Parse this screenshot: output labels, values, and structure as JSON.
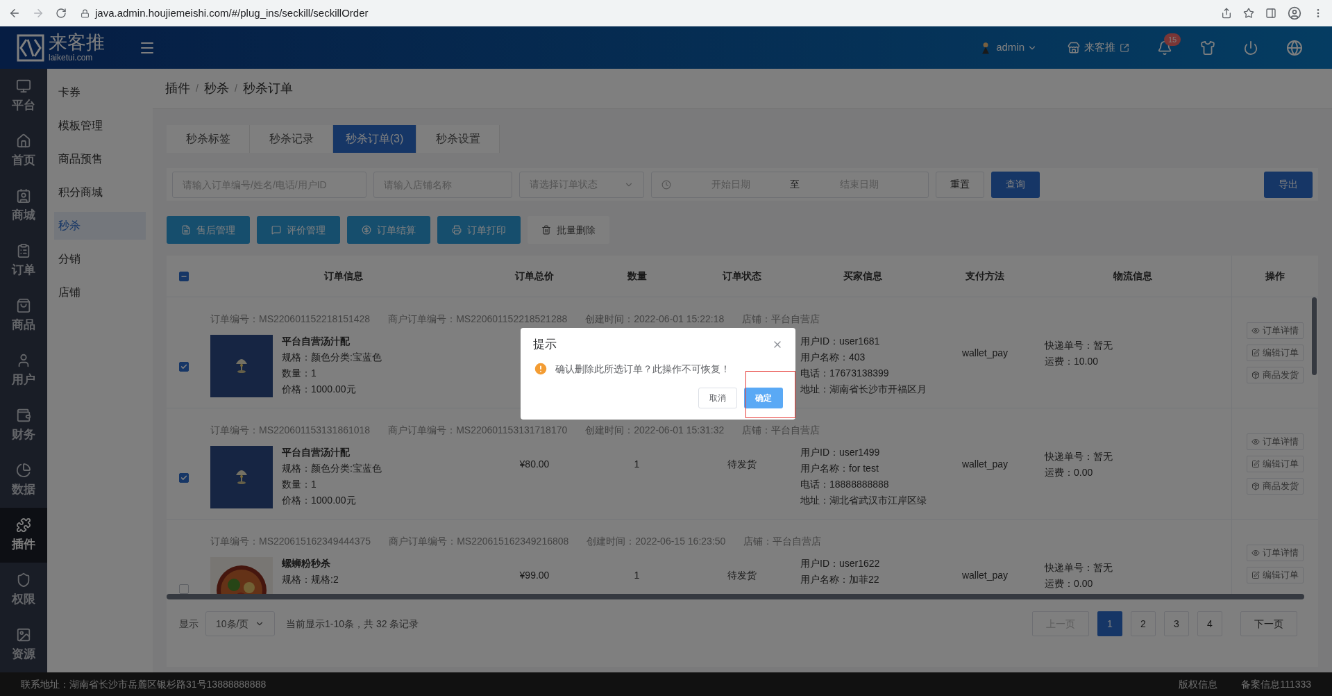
{
  "browser": {
    "url": "java.admin.houjiemeishi.com/#/plug_ins/seckill/seckillOrder"
  },
  "header": {
    "logo_title": "来客推",
    "logo_subtitle": "laiketui.com",
    "user": "admin",
    "store": "来客推",
    "notifications": "15"
  },
  "nav": [
    {
      "kind": "platform",
      "label": "平台",
      "selected": false
    },
    {
      "kind": "home",
      "label": "首页",
      "selected": false
    },
    {
      "kind": "mall",
      "label": "商城",
      "selected": false
    },
    {
      "kind": "order",
      "label": "订单",
      "selected": false
    },
    {
      "kind": "goods",
      "label": "商品",
      "selected": false
    },
    {
      "kind": "user",
      "label": "用户",
      "selected": false
    },
    {
      "kind": "finance",
      "label": "财务",
      "selected": false
    },
    {
      "kind": "data",
      "label": "数据",
      "selected": false
    },
    {
      "kind": "plugin",
      "label": "插件",
      "selected": true
    },
    {
      "kind": "auth",
      "label": "权限",
      "selected": false
    },
    {
      "kind": "resource",
      "label": "资源",
      "selected": false
    }
  ],
  "submenu": [
    {
      "label": "卡券",
      "selected": false
    },
    {
      "label": "模板管理",
      "selected": false
    },
    {
      "label": "商品预售",
      "selected": false
    },
    {
      "label": "积分商城",
      "selected": false
    },
    {
      "label": "秒杀",
      "selected": true
    },
    {
      "label": "分销",
      "selected": false
    },
    {
      "label": "店铺",
      "selected": false
    }
  ],
  "breadcrumb": {
    "separator": "/",
    "items": [
      "插件",
      "秒杀",
      "秒杀订单"
    ]
  },
  "tabs": [
    {
      "label": "秒杀标签",
      "selected": false
    },
    {
      "label": "秒杀记录",
      "selected": false
    },
    {
      "label": "秒杀订单(3)",
      "selected": true
    },
    {
      "label": "秒杀设置",
      "selected": false
    }
  ],
  "filters": {
    "order_placeholder": "请输入订单编号/姓名/电话/用户ID",
    "store_placeholder": "请输入店铺名称",
    "status_placeholder": "请选择订单状态",
    "start_placeholder": "开始日期",
    "separator": "至",
    "end_placeholder": "结束日期",
    "reset": "重置",
    "query": "查询",
    "export": "导出"
  },
  "actions": [
    {
      "kind": "after_sale",
      "label": "售后管理"
    },
    {
      "kind": "review",
      "label": "评价管理"
    },
    {
      "kind": "settle",
      "label": "订单结算"
    },
    {
      "kind": "print",
      "label": "订单打印"
    },
    {
      "kind": "delete",
      "label": "批量删除"
    }
  ],
  "table": {
    "select_all": {
      "indeterminate": true
    },
    "columns": [
      "订单信息",
      "订单总价",
      "数量",
      "订单状态",
      "买家信息",
      "支付方法",
      "物流信息",
      "操作"
    ],
    "rows": [
      {
        "checked": true,
        "order_no": "订单编号：MS220601152218151428",
        "merchant_no": "商户订单编号：MS220601152218521288",
        "created": "创建时间：2022-06-01 15:22:18",
        "store": "店铺：平台自营店",
        "name": "平台自营汤汁配",
        "details": [
          "规格：颜色分类:宝蓝色",
          "数量：1",
          "价格：1000.00元"
        ],
        "buyer": [
          "用户ID：user1681",
          "用户名称：403",
          "电话：17673138399",
          "地址：湖南省长沙市开福区月"
        ],
        "payment": "wallet_pay",
        "logistics": [
          "快递单号：暂无",
          "运费：10.00"
        ],
        "ops": [
          {
            "kind": "view",
            "label": "订单详情"
          },
          {
            "kind": "edit",
            "label": "编辑订单"
          },
          {
            "kind": "ship",
            "label": "商品发货"
          }
        ]
      },
      {
        "checked": true,
        "order_no": "订单编号：MS220601153131861018",
        "merchant_no": "商户订单编号：MS220601153131718170",
        "created": "创建时间：2022-06-01 15:31:32",
        "store": "店铺：平台自营店",
        "name": "平台自营汤汁配",
        "details": [
          "规格：颜色分类:宝蓝色",
          "数量：1",
          "价格：1000.00元"
        ],
        "total": "¥80.00",
        "quantity": "1",
        "status": "待发货",
        "buyer": [
          "用户ID：user1499",
          "用户名称：for test",
          "电话：18888888888",
          "地址：湖北省武汉市江岸区绿"
        ],
        "payment": "wallet_pay",
        "logistics": [
          "快递单号：暂无",
          "运费：0.00"
        ],
        "ops": [
          {
            "kind": "view",
            "label": "订单详情"
          },
          {
            "kind": "edit",
            "label": "编辑订单"
          },
          {
            "kind": "ship",
            "label": "商品发货"
          }
        ]
      },
      {
        "checked": false,
        "order_no": "订单编号：MS220615162349444375",
        "merchant_no": "商户订单编号：MS220615162349216808",
        "created": "创建时间：2022-06-15 16:23:50",
        "store": "店铺：平台自营店",
        "name": "螺蛳粉秒杀",
        "details": [
          "规格：规格:2"
        ],
        "total": "¥99.00",
        "quantity": "1",
        "status": "待发货",
        "buyer": [
          "用户ID：user1622",
          "用户名称：加菲22"
        ],
        "payment": "wallet_pay",
        "logistics": [
          "快递单号：暂无",
          "运费：0.00"
        ],
        "ops": [
          {
            "kind": "view",
            "label": "订单详情"
          },
          {
            "kind": "edit",
            "label": "编辑订单"
          }
        ]
      }
    ]
  },
  "pagination": {
    "display_label": "显示",
    "page_size": "10条/页",
    "summary": "当前显示1-10条，共 32 条记录",
    "prev": "上一页",
    "prev_disabled": true,
    "pages": [
      {
        "label": "1",
        "selected": true
      },
      {
        "label": "2",
        "selected": false
      },
      {
        "label": "3",
        "selected": false
      },
      {
        "label": "4",
        "selected": false
      }
    ],
    "next": "下一页"
  },
  "footer": {
    "address": "联系地址：湖南省长沙市岳麓区银杉路31号13888888888",
    "links": [
      "版权信息",
      "备案信息111333"
    ]
  },
  "dialog": {
    "title": "提示",
    "message": "确认删除此所选订单？此操作不可恢复！",
    "cancel": "取消",
    "confirm": "确定"
  }
}
